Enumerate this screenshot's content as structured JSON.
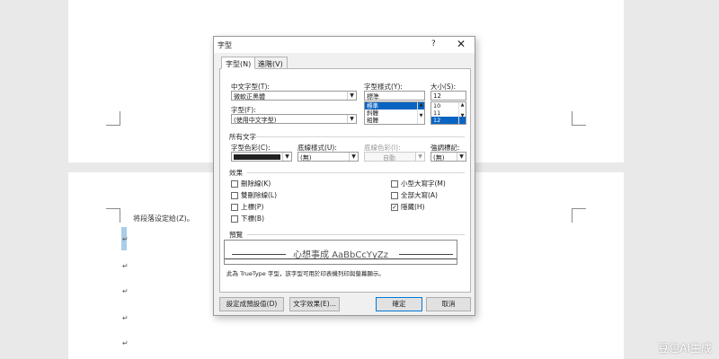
{
  "document": {
    "line_text": "将段落设定给(Z)。",
    "paragraph_mark": "↵"
  },
  "watermark": "豆包AI生成",
  "dialog": {
    "title": "字型",
    "help": "?",
    "close": "✕",
    "tabs": [
      "字型(N)",
      "進階(V)"
    ],
    "chinese_font_label": "中文字型(T):",
    "chinese_font_value": "微軟正黑體",
    "font_label": "字型(F):",
    "font_value": "(使用中文字型)",
    "style_label": "字型樣式(Y):",
    "style_value": "標準",
    "style_options": [
      "標準",
      "斜體",
      "粗體"
    ],
    "size_label": "大小(S):",
    "size_value": "12",
    "size_options": [
      "10",
      "11",
      "12"
    ],
    "all_text_section": "所有文字",
    "font_color_label": "字型色彩(C):",
    "underline_style_label": "底線樣式(U):",
    "underline_style_value": "(無)",
    "underline_color_label": "底線色彩(I):",
    "underline_color_value": "自動",
    "emphasis_label": "強調標記:",
    "emphasis_value": "(無)",
    "effects_section": "效果",
    "effects_left": [
      "刪除線(K)",
      "雙刪除線(L)",
      "上標(P)",
      "下標(B)"
    ],
    "effects_right": [
      "小型大寫字(M)",
      "全部大寫(A)",
      "隱藏(H)"
    ],
    "effects_right_checked": [
      false,
      false,
      true
    ],
    "preview_section": "預覽",
    "preview_text": "心想事成 AaBbCcYyZz",
    "preview_note": "此為 TrueType 字型，該字型可用於印表機列印與螢幕顯示。",
    "buttons": {
      "set_default": "設定成預設值(D)",
      "text_effects": "文字效果(E)...",
      "ok": "確定",
      "cancel": "取消"
    }
  }
}
